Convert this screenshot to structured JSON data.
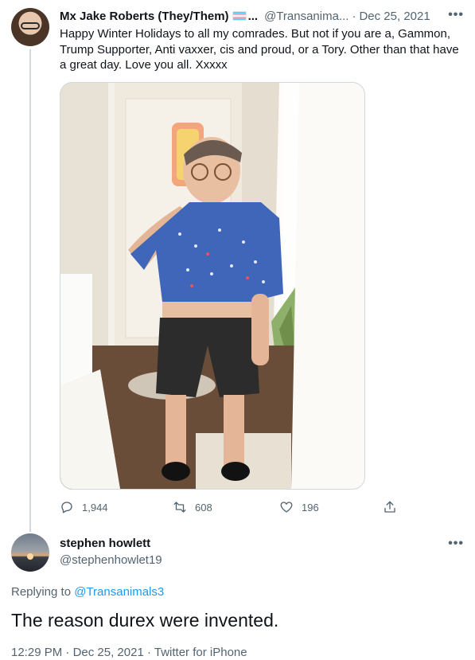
{
  "tweet": {
    "display_name": "Mx Jake Roberts (They/Them)",
    "name_truncation": "...",
    "handle": "@Transanima...",
    "separator": "·",
    "date": "Dec 25, 2021",
    "more_label": "•••",
    "text": "Happy Winter Holidays to all my comrades. But not if you are a, Gammon, Trump Supporter, Anti vaxxer, cis and proud, or a Tory. Other than that have a great day. Love you all. Xxxxx",
    "replies": "1,944",
    "retweets": "608",
    "likes": "196",
    "flag_colors": [
      "#5bcefa",
      "#f5a9b8",
      "#ffffff"
    ]
  },
  "reply": {
    "display_name": "stephen howlett",
    "handle": "@stephenhowlet19",
    "more_label": "•••",
    "replying_prefix": "Replying to",
    "replying_handle": "@Transanimals3",
    "text": "The reason durex were invented.",
    "time": "12:29 PM",
    "separator": "·",
    "date": "Dec 25, 2021",
    "source": "Twitter for iPhone"
  },
  "colors": {
    "text": "#0f1419",
    "secondary": "#536471",
    "link": "#1d9bf0",
    "border": "#cfd9de"
  },
  "icons": [
    "reply-icon",
    "retweet-icon",
    "like-icon",
    "share-icon"
  ]
}
